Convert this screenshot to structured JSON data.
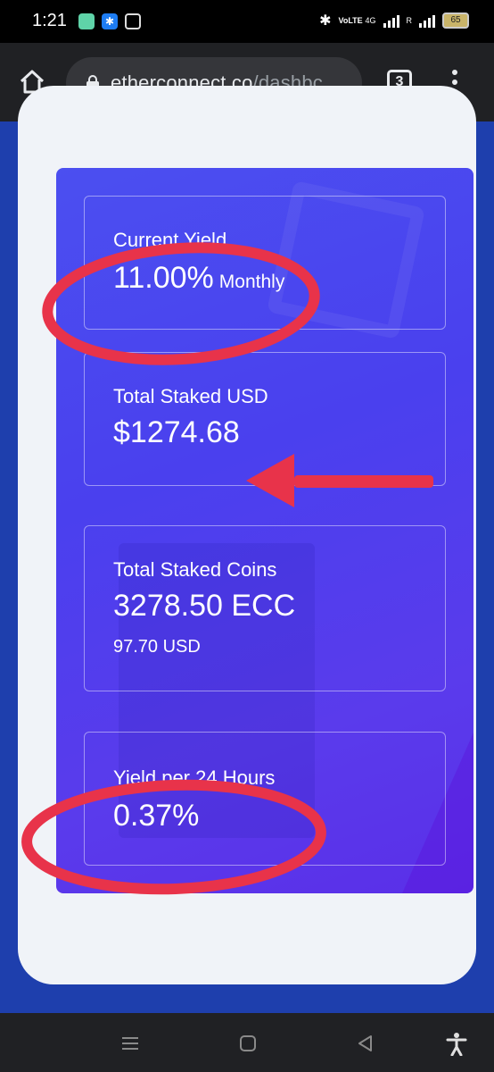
{
  "status_bar": {
    "time": "1:21",
    "network_label": "VoLTE",
    "network_type": "4G",
    "roaming": "R",
    "battery": "65"
  },
  "browser": {
    "url_host": "etherconnect.co",
    "url_path": "/dashbc",
    "tab_count": "3"
  },
  "dashboard": {
    "cards": [
      {
        "label": "Current Yield",
        "value": "11.00%",
        "unit": "Monthly"
      },
      {
        "label": "Total Staked USD",
        "value": "$1274.68"
      },
      {
        "label": "Total Staked Coins",
        "value": "3278.50 ECC",
        "sub": "97.70 USD"
      },
      {
        "label": "Yield per 24 Hours",
        "value": "0.37%"
      }
    ]
  },
  "colors": {
    "annotation_red": "#e8334a",
    "card_gradient_start": "#4b4ff0",
    "card_gradient_end": "#5a2fe8",
    "page_bg": "#1e3fad"
  }
}
